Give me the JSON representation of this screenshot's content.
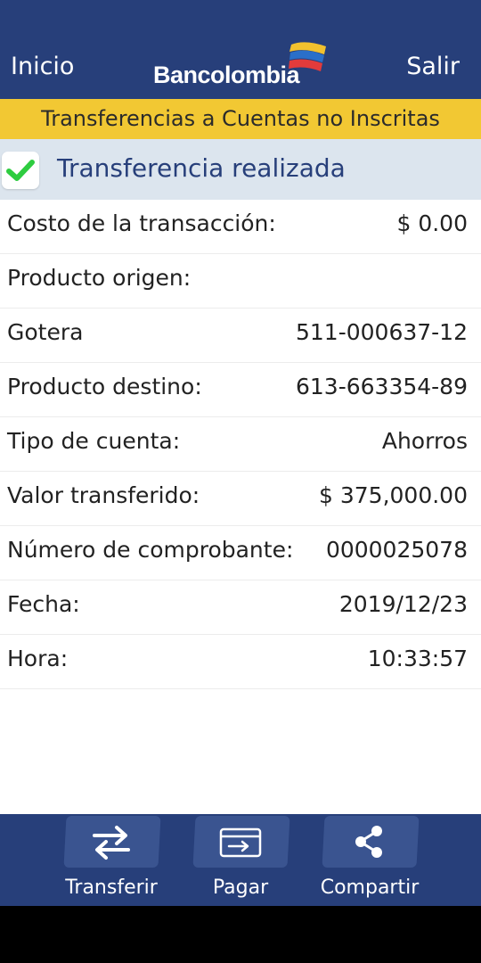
{
  "header": {
    "home_label": "Inicio",
    "logo_text": "Bancolombia",
    "logout_label": "Salir",
    "background_color": "#273f7a"
  },
  "section": {
    "title": "Transferencias a Cuentas no Inscritas",
    "background_color": "#f2c833"
  },
  "status": {
    "icon": "check-icon",
    "message": "Transferencia realizada",
    "icon_color": "#2ecc40"
  },
  "details": [
    {
      "label": "Costo de la transacción:",
      "value": "$ 0.00"
    },
    {
      "label": "Producto origen:",
      "value": ""
    },
    {
      "label": "Gotera",
      "value": "511-000637-12"
    },
    {
      "label": "Producto destino:",
      "value": "613-663354-89"
    },
    {
      "label": "Tipo de cuenta:",
      "value": "Ahorros"
    },
    {
      "label": "Valor transferido:",
      "value": "$ 375,000.00"
    },
    {
      "label": "Número de comprobante:",
      "value": "0000025078"
    },
    {
      "label": "Fecha:",
      "value": "2019/12/23"
    },
    {
      "label": "Hora:",
      "value": "10:33:57"
    }
  ],
  "bottom_nav": [
    {
      "label": "Transferir",
      "icon": "transfer-arrows-icon"
    },
    {
      "label": "Pagar",
      "icon": "card-icon"
    },
    {
      "label": "Compartir",
      "icon": "share-icon"
    }
  ]
}
